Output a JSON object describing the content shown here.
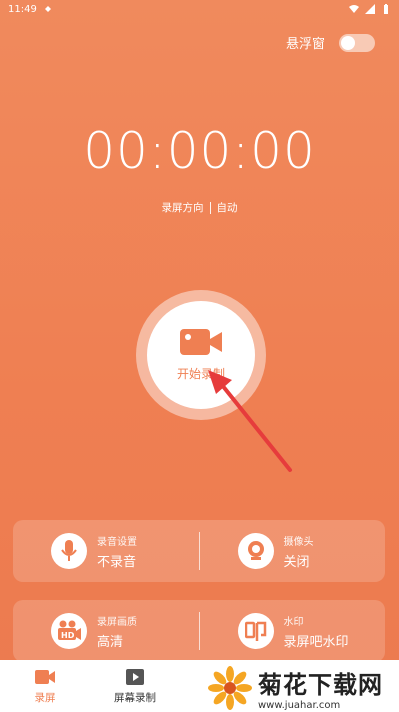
{
  "status_bar": {
    "time": "11:49"
  },
  "float_window": {
    "label": "悬浮窗",
    "enabled": false
  },
  "timer": {
    "value": "00:00:00"
  },
  "direction": {
    "label": "录屏方向",
    "value": "自动"
  },
  "record_button": {
    "label": "开始录制"
  },
  "settings": [
    [
      {
        "title": "录音设置",
        "value": "不录音",
        "icon": "microphone-icon"
      },
      {
        "title": "摄像头",
        "value": "关闭",
        "icon": "camera-icon"
      }
    ],
    [
      {
        "title": "录屏画质",
        "value": "高清",
        "icon": "hd-video-icon"
      },
      {
        "title": "水印",
        "value": "录屏吧水印",
        "icon": "stamp-icon"
      }
    ]
  ],
  "nav": [
    {
      "label": "录屏",
      "icon": "video-camera-icon",
      "active": true
    },
    {
      "label": "屏幕录制",
      "icon": "play-icon",
      "active": false
    }
  ],
  "watermark": {
    "title": "菊花下载网",
    "url": "www.juahar.com"
  },
  "colors": {
    "accent": "#ef7f52",
    "background": "#f08a5d",
    "arrow": "#e63c3c"
  }
}
